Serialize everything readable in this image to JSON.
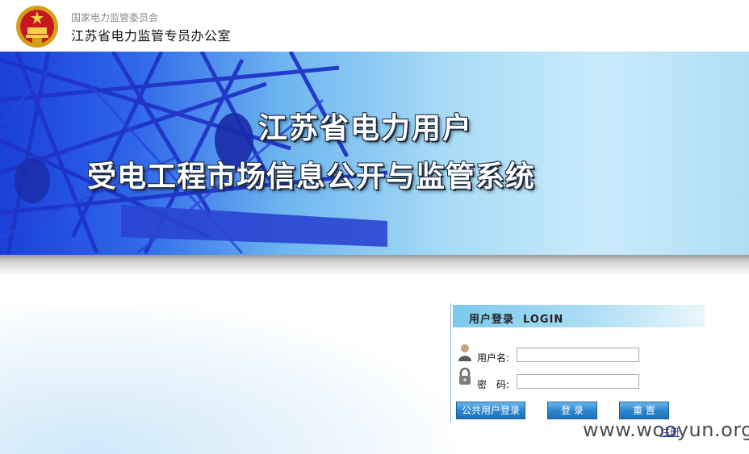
{
  "header": {
    "org_top": "国家电力监管委员会",
    "org_main": "江苏省电力监管专员办公室",
    "emblem_icon": "national-emblem-icon"
  },
  "banner": {
    "title_line1": "江苏省电力用户",
    "title_line2": "受电工程市场信息公开与监管系统"
  },
  "login": {
    "title": "用户登录  LOGIN",
    "username_label": "用户名:",
    "username_value": "",
    "password_label": "密　码:",
    "password_value": "",
    "public_login_button": "公共用户登录",
    "login_button": "登 录",
    "reset_button": "重 置",
    "user_icon": "user-avatar-icon",
    "lock_icon": "lock-icon"
  },
  "footer": {
    "link_text": "注册",
    "watermark": "www.wooyun.org"
  },
  "colors": {
    "accent": "#2f86cf",
    "banner_blue": "#1a3fd8",
    "link": "#1a3ad8"
  }
}
